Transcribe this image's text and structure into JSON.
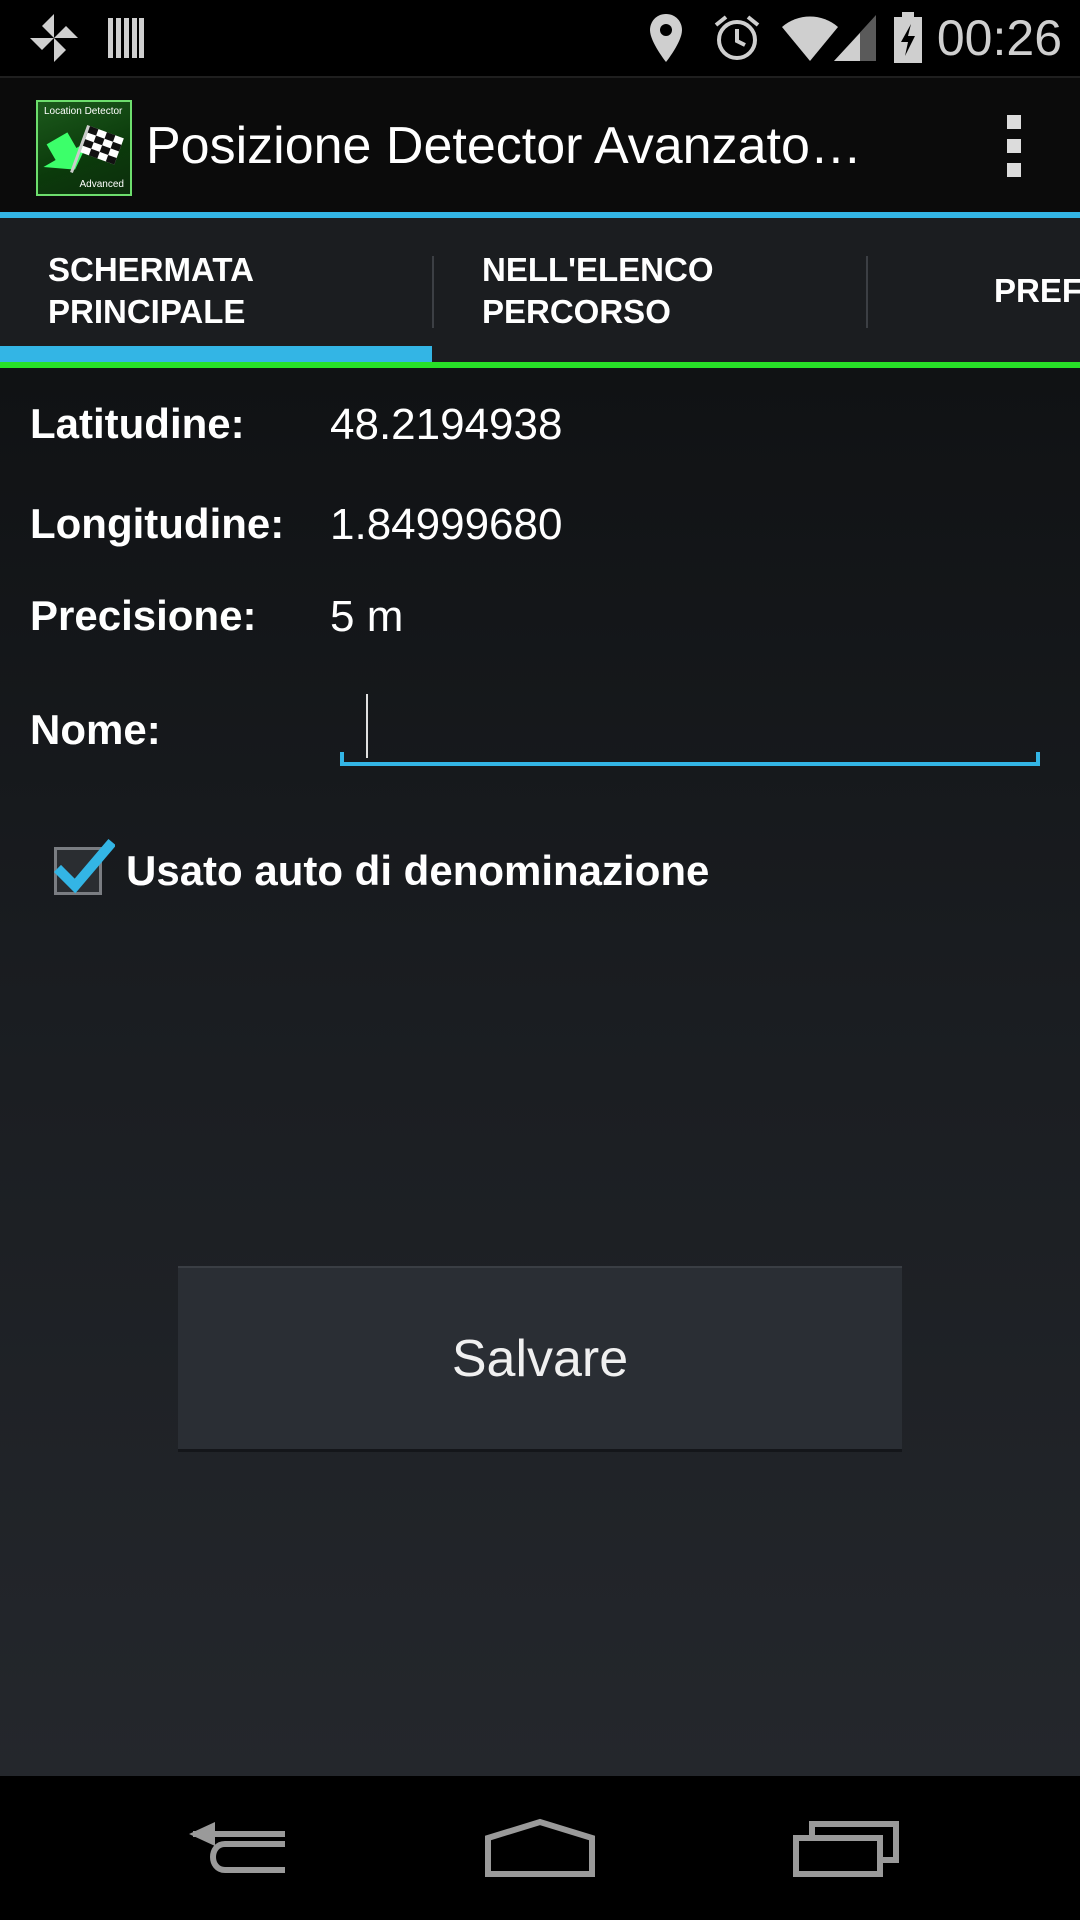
{
  "status_bar": {
    "time": "00:26",
    "icons": [
      "pinwheel-icon",
      "barcode-icon",
      "location-pin-icon",
      "alarm-icon",
      "wifi-icon",
      "cell-signal-icon",
      "battery-charging-icon"
    ]
  },
  "action_bar": {
    "app_icon_text_top": "Location Detector",
    "app_icon_text_bottom": "Advanced",
    "title": "Posizione Detector Avanzato…",
    "overflow_icon": "overflow-menu-icon"
  },
  "tabs": [
    {
      "label": "SCHERMATA\nPRINCIPALE",
      "selected": true
    },
    {
      "label": "NELL'ELENCO\nPERCORSO",
      "selected": false
    },
    {
      "label": "PREF",
      "selected": false
    }
  ],
  "fields": {
    "latitude_label": "Latitudine:",
    "latitude_value": "48.2194938",
    "longitude_label": "Longitudine:",
    "longitude_value": "1.84999680",
    "precision_label": "Precisione:",
    "precision_value": "5 m",
    "name_label": "Nome:",
    "name_value": ""
  },
  "checkbox": {
    "label": "Usato auto di denominazione",
    "checked": true
  },
  "save_button": {
    "label": "Salvare"
  },
  "colors": {
    "accent": "#33b5e5",
    "tab_bottom_line": "#28e028"
  }
}
